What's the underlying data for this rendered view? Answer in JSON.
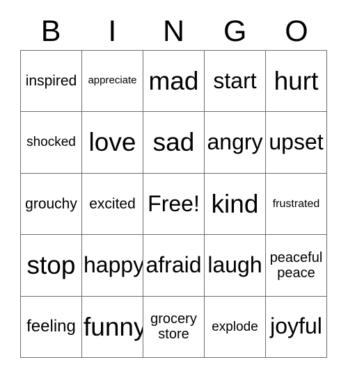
{
  "card": {
    "header_letters": [
      "B",
      "I",
      "N",
      "G",
      "O"
    ],
    "grid": {
      "rows": 5,
      "columns": 5,
      "border_color": "#6b6b6b",
      "background_color": "#ffffff",
      "text_color": "#000000"
    },
    "cells": [
      [
        {
          "text": "inspired",
          "size": "m"
        },
        {
          "text": "appreciate",
          "size": "xs"
        },
        {
          "text": "mad",
          "size": "xxl"
        },
        {
          "text": "start",
          "size": "xl"
        },
        {
          "text": "hurt",
          "size": "xxl"
        }
      ],
      [
        {
          "text": "shocked",
          "size": "sm"
        },
        {
          "text": "love",
          "size": "xxl"
        },
        {
          "text": "sad",
          "size": "xxl"
        },
        {
          "text": "angry",
          "size": "xl"
        },
        {
          "text": "upset",
          "size": "xl"
        }
      ],
      [
        {
          "text": "grouchy",
          "size": "m"
        },
        {
          "text": "excited",
          "size": "m"
        },
        {
          "text": "Free!",
          "size": "xl"
        },
        {
          "text": "kind",
          "size": "xxl"
        },
        {
          "text": "frustrated",
          "size": "s"
        }
      ],
      [
        {
          "text": "stop",
          "size": "xxl"
        },
        {
          "text": "happy",
          "size": "xl"
        },
        {
          "text": "afraid",
          "size": "xl"
        },
        {
          "text": "laugh",
          "size": "xl"
        },
        {
          "text": "peaceful\npeace",
          "size": "two"
        }
      ],
      [
        {
          "text": "feeling",
          "size": "ml"
        },
        {
          "text": "funny",
          "size": "xxl"
        },
        {
          "text": "grocery\nstore",
          "size": "two"
        },
        {
          "text": "explode",
          "size": "sm"
        },
        {
          "text": "joyful",
          "size": "xl"
        }
      ]
    ]
  }
}
